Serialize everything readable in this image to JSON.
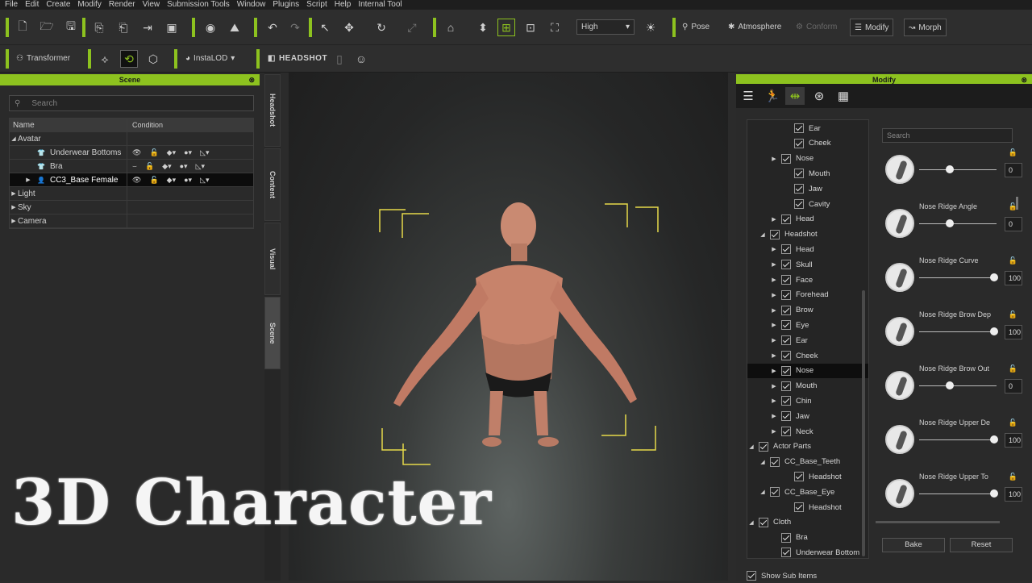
{
  "menu": [
    "File",
    "Edit",
    "Create",
    "Modify",
    "Render",
    "View",
    "Submission Tools",
    "Window",
    "Plugins",
    "Script",
    "Help",
    "Internal Tool"
  ],
  "toolbar1": {
    "quality": "High",
    "pose": "Pose",
    "atmosphere": "Atmosphere",
    "conform": "Conform",
    "modify": "Modify",
    "morph": "Morph"
  },
  "toolbar2": {
    "transformer": "Transformer",
    "instalod": "InstaLOD",
    "headshot": "HEADSHOT"
  },
  "scene": {
    "title": "Scene",
    "search_placeholder": "Search",
    "col_name": "Name",
    "col_condition": "Condition",
    "rows": [
      {
        "label": "Avatar"
      },
      {
        "label": "Underwear Bottoms"
      },
      {
        "label": "Bra"
      },
      {
        "label": "CC3_Base Female"
      },
      {
        "label": "Light"
      },
      {
        "label": "Sky"
      },
      {
        "label": "Camera"
      }
    ]
  },
  "side_tabs": [
    "Headshot",
    "Content",
    "Visual",
    "Scene"
  ],
  "modify": {
    "title": "Modify",
    "search_placeholder": "Search",
    "tree": [
      "Ear",
      "Cheek",
      "Nose",
      "Mouth",
      "Jaw",
      "Cavity",
      "Head",
      "Headshot",
      "Head",
      "Skull",
      "Face",
      "Forehead",
      "Brow",
      "Eye",
      "Ear",
      "Cheek",
      "Nose",
      "Mouth",
      "Chin",
      "Jaw",
      "Neck",
      "Actor Parts",
      "CC_Base_Teeth",
      "Headshot",
      "CC_Base_Eye",
      "Headshot",
      "Cloth",
      "Bra",
      "Underwear Bottom"
    ],
    "sliders": [
      {
        "label": "",
        "value": "0",
        "pos": 0.4
      },
      {
        "label": "Nose Ridge Angle",
        "value": "0",
        "pos": 0.4
      },
      {
        "label": "Nose Ridge Curve",
        "value": "100",
        "pos": 1.0
      },
      {
        "label": "Nose Ridge Brow Dep",
        "value": "100",
        "pos": 1.0
      },
      {
        "label": "Nose Ridge Brow Out",
        "value": "0",
        "pos": 0.4
      },
      {
        "label": "Nose Ridge Upper De",
        "value": "100",
        "pos": 1.0
      },
      {
        "label": "Nose Ridge Upper To",
        "value": "100",
        "pos": 1.0
      }
    ],
    "bake": "Bake",
    "reset": "Reset",
    "show_sub_items": "Show Sub Items"
  },
  "caption": "3D Character"
}
